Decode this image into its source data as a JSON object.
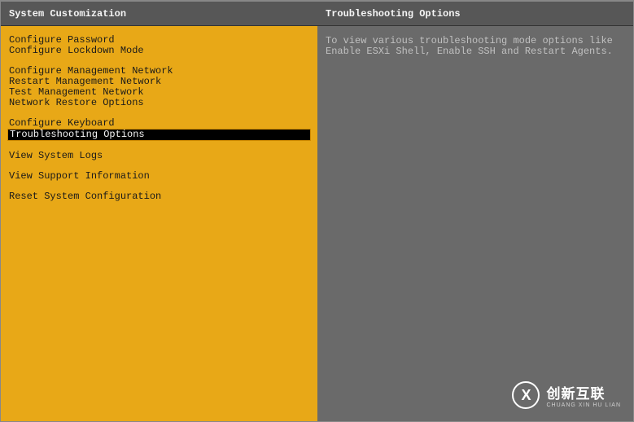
{
  "left": {
    "title": "System Customization",
    "groups": [
      [
        "Configure Password",
        "Configure Lockdown Mode"
      ],
      [
        "Configure Management Network",
        "Restart Management Network",
        "Test Management Network",
        "Network Restore Options"
      ],
      [
        "Configure Keyboard",
        "Troubleshooting Options"
      ],
      [
        "View System Logs"
      ],
      [
        "View Support Information"
      ],
      [
        "Reset System Configuration"
      ]
    ],
    "selected": "Troubleshooting Options"
  },
  "right": {
    "title": "Troubleshooting Options",
    "detail": "To view various troubleshooting mode options like Enable ESXi Shell, Enable SSH and Restart Agents."
  },
  "watermark": {
    "icon_letter": "X",
    "main": "创新互联",
    "sub": "CHUANG XIN HU LIAN"
  }
}
